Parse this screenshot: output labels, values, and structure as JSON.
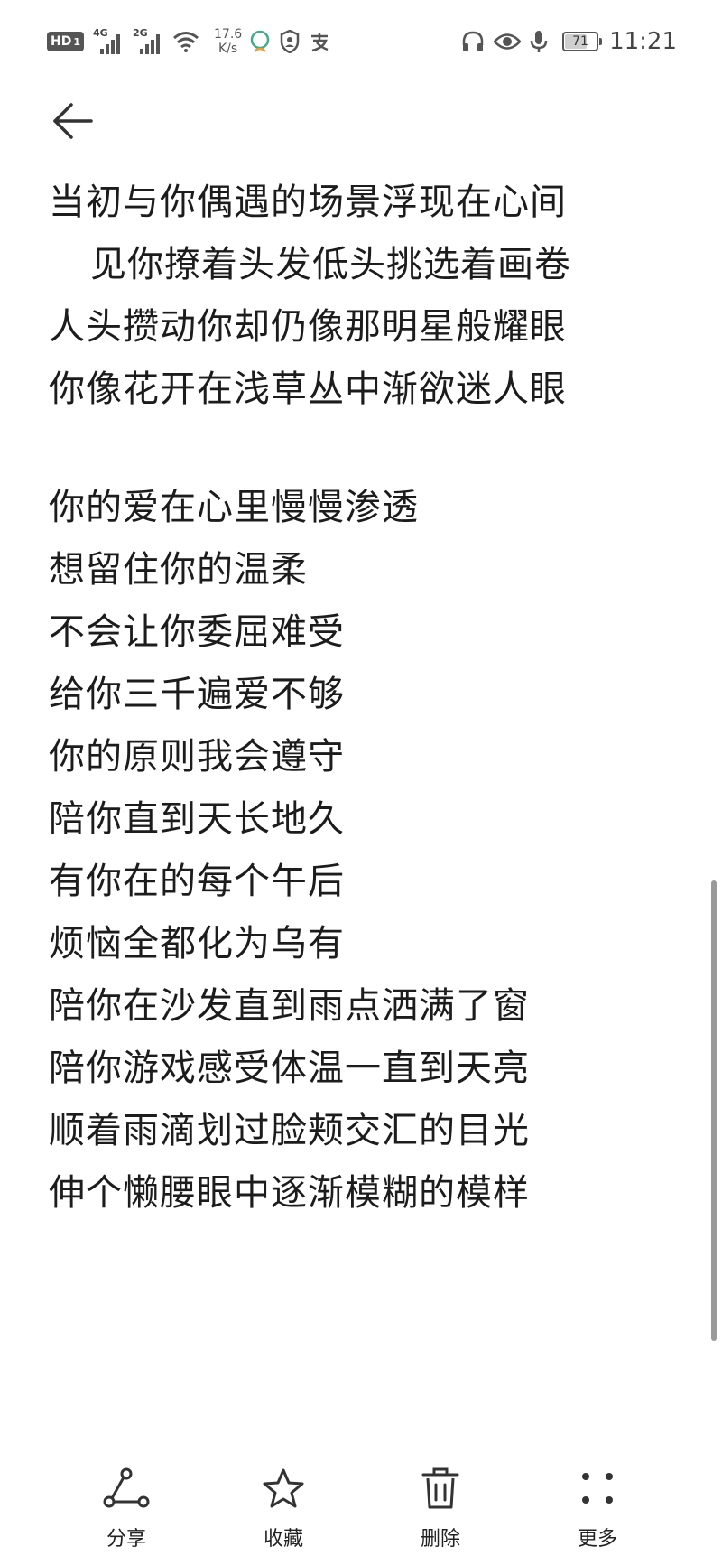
{
  "status_bar": {
    "hd_label": "HD",
    "hd_sub": "1",
    "signal_1_label": "4G",
    "signal_2_label": "2G",
    "net_speed_value": "17.6",
    "net_speed_unit": "K/s",
    "battery_level": "71",
    "time": "11:21"
  },
  "note": {
    "stanza_1": [
      "当初与你偶遇的场景浮现在心间",
      "见你撩着头发低头挑选着画卷",
      "人头攒动你却仍像那明星般耀眼",
      "你像花开在浅草丛中渐欲迷人眼"
    ],
    "stanza_2": [
      "你的爱在心里慢慢渗透",
      "想留住你的温柔",
      "不会让你委屈难受",
      "给你三千遍爱不够",
      "你的原则我会遵守",
      "陪你直到天长地久",
      "有你在的每个午后",
      "烦恼全都化为乌有",
      "陪你在沙发直到雨点洒满了窗",
      "陪你游戏感受体温一直到天亮",
      "顺着雨滴划过脸颊交汇的目光",
      "伸个懒腰眼中逐渐模糊的模样"
    ]
  },
  "toolbar": {
    "share_label": "分享",
    "favorite_label": "收藏",
    "delete_label": "删除",
    "more_label": "更多"
  },
  "icons": {
    "back": "arrow-left-icon",
    "share": "share-icon",
    "favorite": "star-icon",
    "delete": "trash-icon",
    "more": "more-dots-icon"
  },
  "colors": {
    "text": "#1c1c1c",
    "background": "#ffffff",
    "icon": "#333333"
  }
}
